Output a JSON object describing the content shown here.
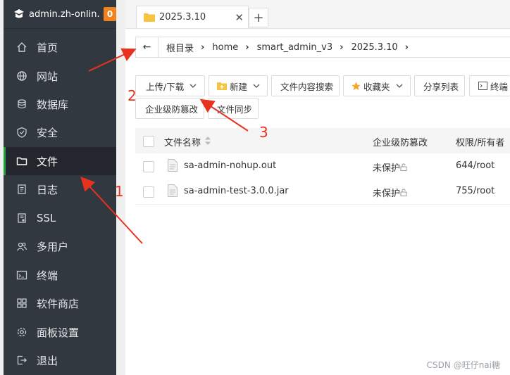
{
  "sidebar": {
    "brand": "admin.zh-onlin...",
    "badge": "0",
    "items": [
      {
        "label": "首页",
        "icon": "home-icon"
      },
      {
        "label": "网站",
        "icon": "globe-icon"
      },
      {
        "label": "数据库",
        "icon": "database-icon"
      },
      {
        "label": "安全",
        "icon": "shield-icon"
      },
      {
        "label": "文件",
        "icon": "folder-icon",
        "active": true
      },
      {
        "label": "日志",
        "icon": "log-icon"
      },
      {
        "label": "SSL",
        "icon": "ssl-icon"
      },
      {
        "label": "多用户",
        "icon": "users-icon"
      },
      {
        "label": "终端",
        "icon": "terminal-icon"
      },
      {
        "label": "软件商店",
        "icon": "apps-icon"
      },
      {
        "label": "面板设置",
        "icon": "gear-icon"
      },
      {
        "label": "退出",
        "icon": "logout-icon"
      }
    ]
  },
  "tabs": {
    "active_tab": "2025.3.10",
    "close": "✕",
    "add": "+"
  },
  "breadcrumb": {
    "back": "←",
    "items": [
      "根目录",
      "home",
      "smart_admin_v3",
      "2025.3.10"
    ]
  },
  "toolbar": {
    "upload_download": "上传/下载",
    "new": "新建",
    "content_search": "文件内容搜索",
    "favorites": "收藏夹",
    "share_list": "分享列表",
    "terminal": "终端",
    "tamper_proof": "企业级防篡改",
    "file_sync": "文件同步"
  },
  "table": {
    "headers": {
      "name": "文件名称",
      "tamper": "企业级防篡改",
      "perm": "权限/所有者"
    },
    "rows": [
      {
        "name": "sa-admin-nohup.out",
        "tamper": "未保护",
        "perm": "644/root"
      },
      {
        "name": "sa-admin-test-3.0.0.jar",
        "tamper": "未保护",
        "perm": "755/root"
      }
    ]
  },
  "annotations": {
    "one": "1",
    "two": "2",
    "three": "3",
    "color": "#e8321f"
  },
  "watermark": "CSDN @旺仔nai糖",
  "colors": {
    "sidebar": "#32383f",
    "active_indicator": "#20a53a",
    "badge": "#f0831f"
  }
}
